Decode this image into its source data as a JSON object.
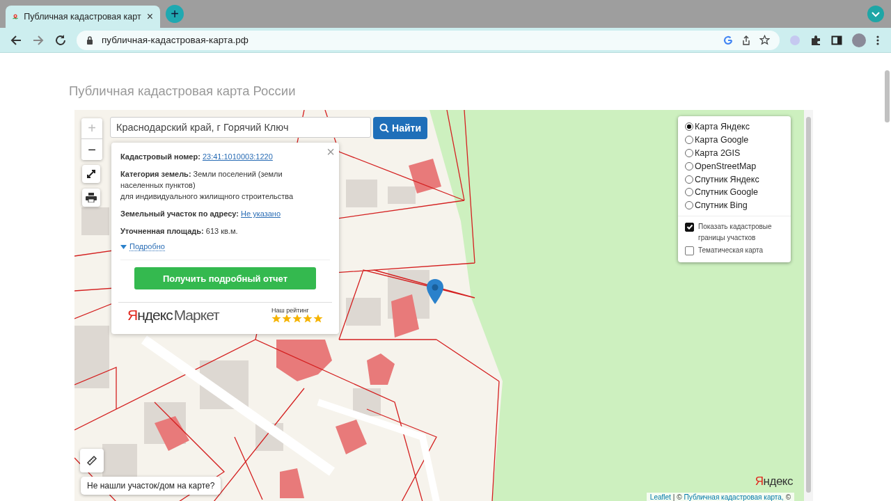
{
  "browser": {
    "tab_title": "Публичная кадастровая карт",
    "tab_close": "×",
    "new_tab": "+",
    "url": "публичная-кадастровая-карта.рф"
  },
  "page_title": "Публичная кадастровая карта России",
  "map": {
    "zoom_in": "+",
    "zoom_out": "−",
    "search": {
      "value": "Краснодарский край, г Горячий Ключ",
      "button": "Найти"
    },
    "popup": {
      "close": "×",
      "fields": [
        {
          "label": "Кадастровый номер:",
          "kind": "link",
          "lines": [
            "23:41:1010003:1220"
          ]
        },
        {
          "label": "Категория земель:",
          "kind": "text",
          "lines": [
            "Земли поселений (земли",
            "населенных пунктов)",
            "для индивидуального жилищного строительства"
          ]
        },
        {
          "label": "Земельный участок по адресу:",
          "kind": "link",
          "lines": [
            "Не указано"
          ]
        },
        {
          "label": "Уточненная площадь:",
          "kind": "text",
          "lines": [
            "613 кв.м."
          ]
        }
      ],
      "details": "Подробно",
      "report_button": "Получить подробный отчет",
      "market_logo": {
        "first": "Я",
        "rest": "ндекс",
        "second": "Маркет"
      },
      "rating_label": "Наш рейтинг",
      "stars": 5
    },
    "layers": [
      {
        "label": "Карта Яндекс",
        "selected": true
      },
      {
        "label": "Карта Google",
        "selected": false
      },
      {
        "label": "Карта 2GIS",
        "selected": false
      },
      {
        "label": "OpenStreetMap",
        "selected": false
      },
      {
        "label": "Спутник Яндекс",
        "selected": false
      },
      {
        "label": "Спутник Google",
        "selected": false
      },
      {
        "label": "Спутник Bing",
        "selected": false
      }
    ],
    "overlays": [
      {
        "label": "Показать кадастровые границы участков",
        "checked": true
      },
      {
        "label": "Тематическая карта",
        "checked": false
      }
    ],
    "not_found": "Не нашли участок/дом на карте?",
    "provider_logo": {
      "first": "Я",
      "rest": "ндекс"
    },
    "attribution": {
      "link1": "Leaflet",
      "separator": "| ©",
      "link2": "Публичная кадастровая карта,",
      "tail": "©"
    }
  }
}
